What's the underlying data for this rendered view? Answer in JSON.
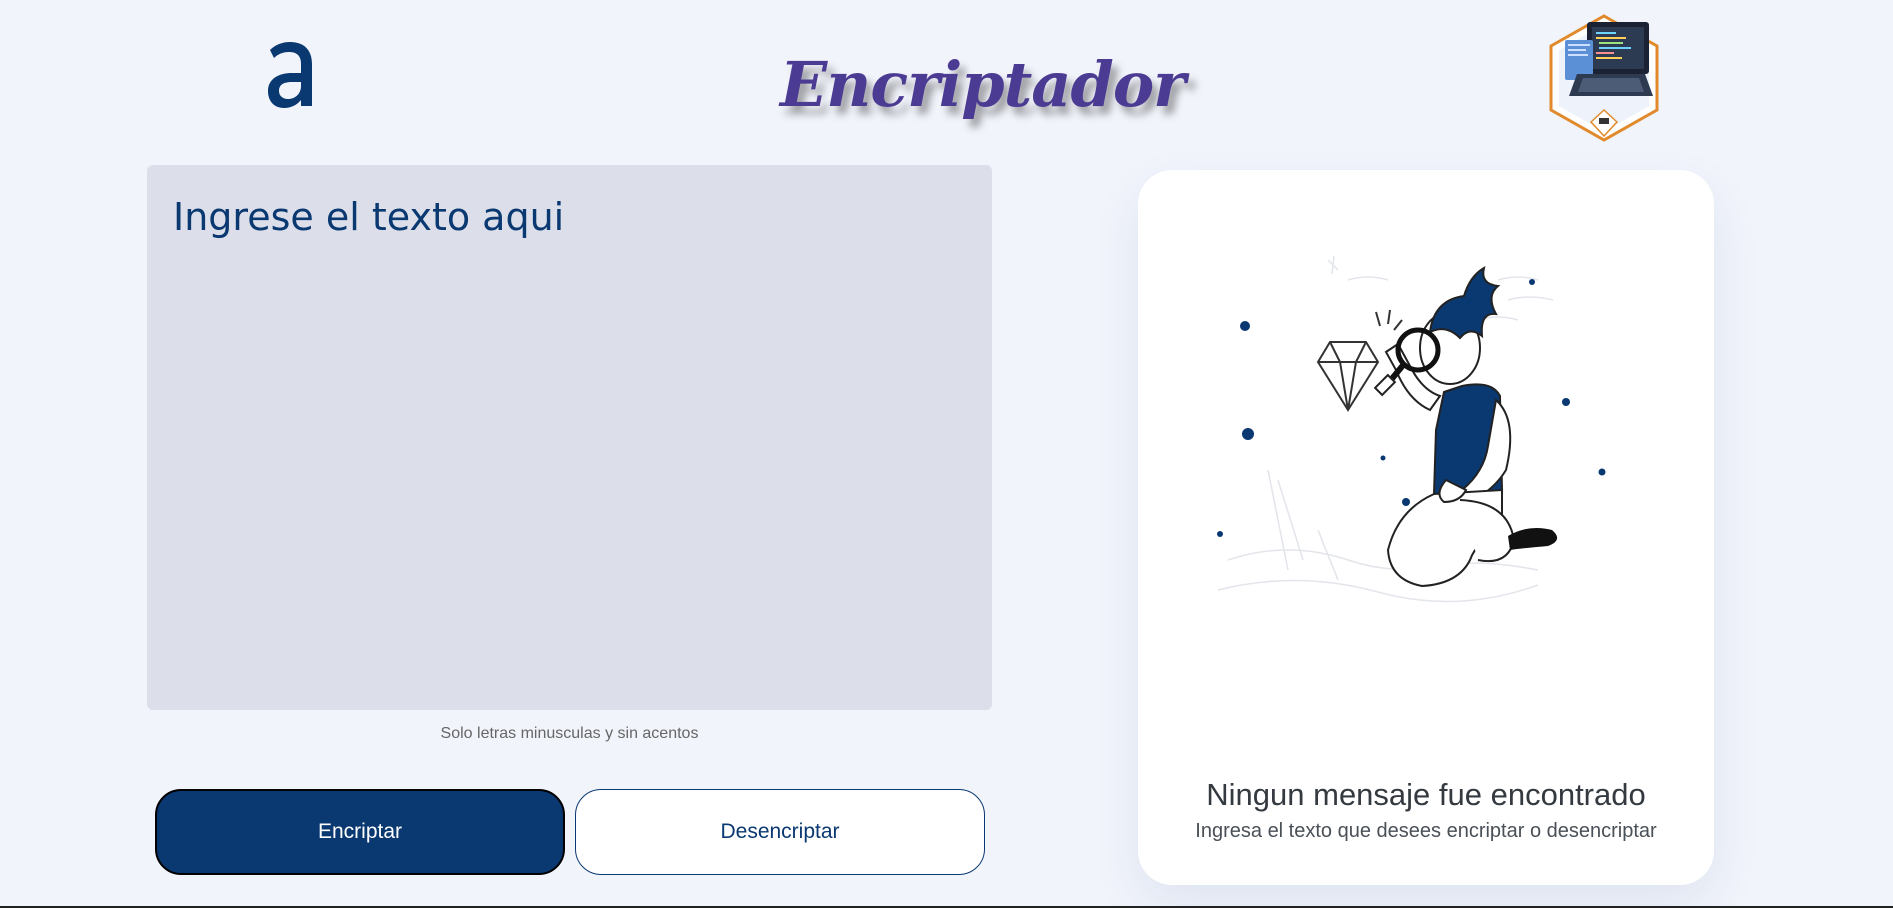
{
  "header": {
    "logo_icon": "alura-a-logo-icon",
    "title": "Encriptador",
    "badge_icon": "laptop-code-badge-icon"
  },
  "input": {
    "placeholder": "Ingrese el texto aqui",
    "value": "",
    "hint": "Solo letras minusculas y sin acentos"
  },
  "buttons": {
    "encrypt_label": "Encriptar",
    "decrypt_label": "Desencriptar"
  },
  "output": {
    "illustration_icon": "person-with-magnifying-glass-diamond-icon",
    "title": "Ningun mensaje fue encontrado",
    "subtitle": "Ingresa el texto que desees encriptar o desencriptar"
  },
  "colors": {
    "page_background": "#f1f4fb",
    "primary": "#0a3871",
    "title_color": "#4c3b93",
    "textarea_background": "#dcdfe9",
    "card_background": "#ffffff"
  }
}
